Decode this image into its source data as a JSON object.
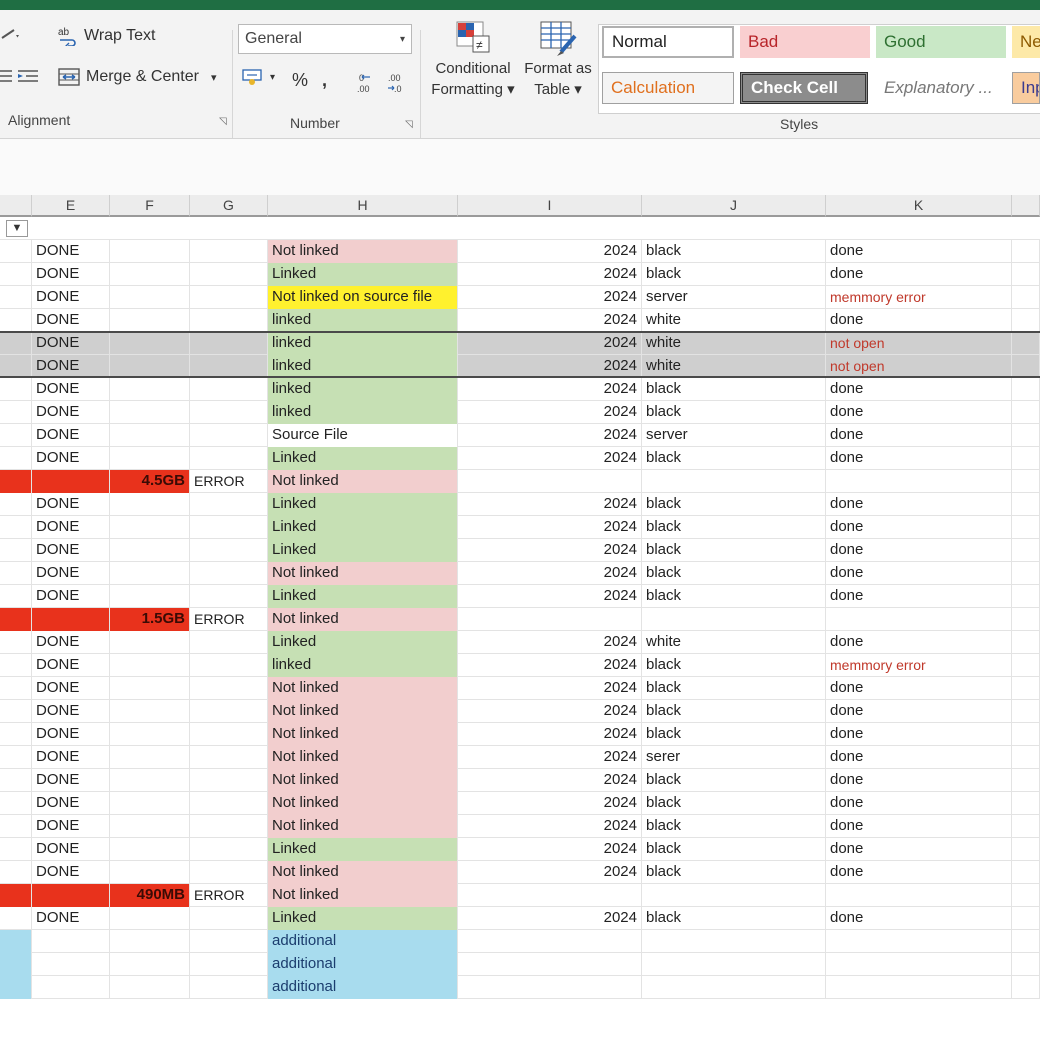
{
  "colors": {
    "titlebar": "#1f6e43",
    "linked_fill": "#c6e0b4",
    "not_linked_fill": "#f2cece",
    "yellow_fill": "#fff12e",
    "additional_fill": "#a8dcee",
    "error_fill": "#e8321c",
    "error_text": "#c0392b",
    "selected_row_fill": "#cfcfcf"
  },
  "ribbon": {
    "alignment": {
      "wrap_text": "Wrap Text",
      "merge_center": "Merge & Center",
      "group_label": "Alignment"
    },
    "number": {
      "format_value": "General",
      "percent": "%",
      "comma": ",",
      "group_label": "Number"
    },
    "conditional_formatting": {
      "line1": "Conditional",
      "line2": "Formatting ▾"
    },
    "format_as_table": {
      "line1": "Format as",
      "line2": "Table ▾"
    },
    "styles": {
      "group_label": "Styles",
      "normal": "Normal",
      "bad": "Bad",
      "good": "Good",
      "neutral": "Ne",
      "calculation": "Calculation",
      "check_cell": "Check Cell",
      "explanatory": "Explanatory ...",
      "input": "Inp"
    }
  },
  "columns": [
    "E",
    "F",
    "G",
    "H",
    "I",
    "J",
    "K"
  ],
  "rows": [
    {
      "e": "DONE",
      "f": "",
      "g": "",
      "h": "Not linked",
      "hc": "red",
      "i": "2024",
      "j": "black",
      "k": "done",
      "kc": "normal"
    },
    {
      "e": "DONE",
      "f": "",
      "g": "",
      "h": "Linked",
      "hc": "green",
      "i": "2024",
      "j": "black",
      "k": "done",
      "kc": "normal"
    },
    {
      "e": "DONE",
      "f": "",
      "g": "",
      "h": "Not linked on source file",
      "hc": "yellow",
      "i": "2024",
      "j": "server",
      "k": "memmory error",
      "kc": "red"
    },
    {
      "e": "DONE",
      "f": "",
      "g": "",
      "h": "linked",
      "hc": "green",
      "i": "2024",
      "j": "white",
      "k": "done",
      "kc": "normal"
    },
    {
      "e": "DONE",
      "f": "",
      "g": "",
      "h": "linked",
      "hc": "green",
      "i": "2024",
      "j": "white",
      "k": "not open",
      "kc": "red",
      "sel": true
    },
    {
      "e": "DONE",
      "f": "",
      "g": "",
      "h": "linked",
      "hc": "green",
      "i": "2024",
      "j": "white",
      "k": "not open",
      "kc": "red",
      "sel": true
    },
    {
      "e": "DONE",
      "f": "",
      "g": "",
      "h": "linked",
      "hc": "green",
      "i": "2024",
      "j": "black",
      "k": "done",
      "kc": "normal"
    },
    {
      "e": "DONE",
      "f": "",
      "g": "",
      "h": "linked",
      "hc": "green",
      "i": "2024",
      "j": "black",
      "k": "done",
      "kc": "normal"
    },
    {
      "e": "DONE",
      "f": "",
      "g": "",
      "h": "Source File",
      "hc": "white",
      "i": "2024",
      "j": "server",
      "k": "done",
      "kc": "normal"
    },
    {
      "e": "DONE",
      "f": "",
      "g": "",
      "h": "Linked",
      "hc": "green",
      "i": "2024",
      "j": "black",
      "k": "done",
      "kc": "normal"
    },
    {
      "e": "",
      "f": "4.5GB",
      "g": "ERROR",
      "h": "Not linked",
      "hc": "red",
      "i": "",
      "j": "",
      "k": "",
      "kc": "normal",
      "err": true
    },
    {
      "e": "DONE",
      "f": "",
      "g": "",
      "h": "Linked",
      "hc": "green",
      "i": "2024",
      "j": "black",
      "k": "done",
      "kc": "normal"
    },
    {
      "e": "DONE",
      "f": "",
      "g": "",
      "h": "Linked",
      "hc": "green",
      "i": "2024",
      "j": "black",
      "k": "done",
      "kc": "normal"
    },
    {
      "e": "DONE",
      "f": "",
      "g": "",
      "h": "Linked",
      "hc": "green",
      "i": "2024",
      "j": "black",
      "k": "done",
      "kc": "normal"
    },
    {
      "e": "DONE",
      "f": "",
      "g": "",
      "h": "Not linked",
      "hc": "red",
      "i": "2024",
      "j": "black",
      "k": "done",
      "kc": "normal"
    },
    {
      "e": "DONE",
      "f": "",
      "g": "",
      "h": "Linked",
      "hc": "green",
      "i": "2024",
      "j": "black",
      "k": "done",
      "kc": "normal"
    },
    {
      "e": "",
      "f": "1.5GB",
      "g": "ERROR",
      "h": "Not linked",
      "hc": "red",
      "i": "",
      "j": "",
      "k": "",
      "kc": "normal",
      "err": true
    },
    {
      "e": "DONE",
      "f": "",
      "g": "",
      "h": "Linked",
      "hc": "green",
      "i": "2024",
      "j": "white",
      "k": "done",
      "kc": "normal"
    },
    {
      "e": "DONE",
      "f": "",
      "g": "",
      "h": "linked",
      "hc": "green",
      "i": "2024",
      "j": "black",
      "k": "memmory error",
      "kc": "red"
    },
    {
      "e": "DONE",
      "f": "",
      "g": "",
      "h": "Not linked",
      "hc": "red",
      "i": "2024",
      "j": "black",
      "k": "done",
      "kc": "normal"
    },
    {
      "e": "DONE",
      "f": "",
      "g": "",
      "h": "Not linked",
      "hc": "red",
      "i": "2024",
      "j": "black",
      "k": "done",
      "kc": "normal"
    },
    {
      "e": "DONE",
      "f": "",
      "g": "",
      "h": "Not linked",
      "hc": "red",
      "i": "2024",
      "j": "black",
      "k": "done",
      "kc": "normal"
    },
    {
      "e": "DONE",
      "f": "",
      "g": "",
      "h": "Not linked",
      "hc": "red",
      "i": "2024",
      "j": "serer",
      "k": "done",
      "kc": "normal"
    },
    {
      "e": "DONE",
      "f": "",
      "g": "",
      "h": "Not linked",
      "hc": "red",
      "i": "2024",
      "j": "black",
      "k": "done",
      "kc": "normal"
    },
    {
      "e": "DONE",
      "f": "",
      "g": "",
      "h": "Not linked",
      "hc": "red",
      "i": "2024",
      "j": "black",
      "k": "done",
      "kc": "normal"
    },
    {
      "e": "DONE",
      "f": "",
      "g": "",
      "h": "Not linked",
      "hc": "red",
      "i": "2024",
      "j": "black",
      "k": "done",
      "kc": "normal"
    },
    {
      "e": "DONE",
      "f": "",
      "g": "",
      "h": "Linked",
      "hc": "green",
      "i": "2024",
      "j": "black",
      "k": "done",
      "kc": "normal"
    },
    {
      "e": "DONE",
      "f": "",
      "g": "",
      "h": "Not linked",
      "hc": "red",
      "i": "2024",
      "j": "black",
      "k": "done",
      "kc": "normal"
    },
    {
      "e": "",
      "f": "490MB",
      "g": "ERROR",
      "h": "Not linked",
      "hc": "red",
      "i": "",
      "j": "",
      "k": "",
      "kc": "normal",
      "err": true
    },
    {
      "e": "DONE",
      "f": "",
      "g": "",
      "h": "Linked",
      "hc": "green",
      "i": "2024",
      "j": "black",
      "k": "done",
      "kc": "normal"
    },
    {
      "e": "",
      "f": "",
      "g": "",
      "h": "additional",
      "hc": "blue",
      "i": "",
      "j": "",
      "k": "",
      "kc": "normal",
      "blueD": true
    },
    {
      "e": "",
      "f": "",
      "g": "",
      "h": "additional",
      "hc": "blue",
      "i": "",
      "j": "",
      "k": "",
      "kc": "normal",
      "blueD": true
    },
    {
      "e": "",
      "f": "",
      "g": "",
      "h": "additional",
      "hc": "blue",
      "i": "",
      "j": "",
      "k": "",
      "kc": "normal",
      "blueD": true
    }
  ]
}
